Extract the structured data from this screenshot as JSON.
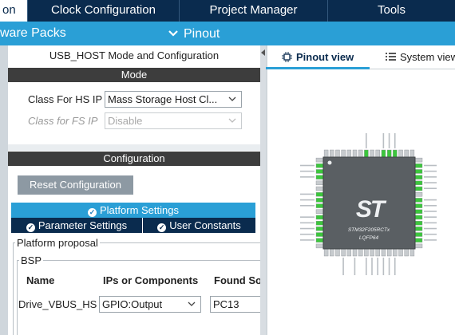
{
  "topbar": {
    "tabs": [
      {
        "label": "on",
        "active": true
      },
      {
        "label": "Clock Configuration",
        "active": false
      },
      {
        "label": "Project Manager",
        "active": false
      },
      {
        "label": "Tools",
        "active": false
      }
    ]
  },
  "subbar": {
    "packs_label": "ware Packs",
    "pinout_label": "Pinout",
    "pinout_icon": "chevron-down-icon"
  },
  "mode_panel": {
    "title": "USB_HOST Mode and Configuration",
    "mode_header": "Mode",
    "class_hs_label": "Class For HS IP",
    "class_hs_value": "Mass Storage Host Cl...",
    "class_fs_label": "Class for FS IP",
    "class_fs_value": "Disable"
  },
  "config_panel": {
    "header": "Configuration",
    "reset_button": "Reset Configuration",
    "tabs": {
      "platform": "Platform Settings",
      "parameter": "Parameter Settings",
      "user": "User Constants"
    },
    "platform_proposal": "Platform proposal",
    "bsp_legend": "BSP",
    "table_headers": {
      "name": "Name",
      "ips": "IPs or Components",
      "found": "Found So"
    },
    "rows": [
      {
        "name": "Drive_VBUS_HS",
        "ip": "GPIO:Output",
        "found": "PC13"
      }
    ]
  },
  "pinout_view": {
    "tab_pinout": "Pinout view",
    "tab_system": "System view",
    "chip_name": "STM32F205RCTx",
    "chip_package": "LQFP64",
    "logo_text": "ST"
  },
  "colors": {
    "topbar": "#0a2b4e",
    "accent": "#2a9fd6",
    "header_dark": "#3d3d3d",
    "chip_body": "#5a5f63",
    "pin_green": "#3cc63c",
    "pin_grey": "#c7cbce"
  }
}
